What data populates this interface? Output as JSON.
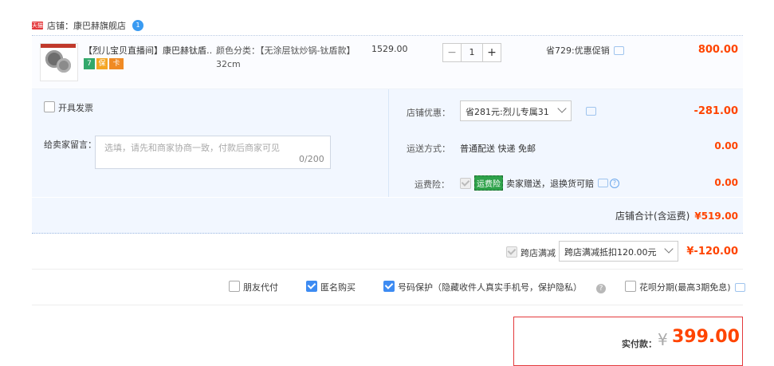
{
  "shop": {
    "badge": "天猫",
    "label": "店铺：",
    "name": "康巴赫旗舰店",
    "ww_badge": "1"
  },
  "item": {
    "title": "【烈儿宝贝直播间】康巴赫钛盾…",
    "badges": [
      "7",
      "保",
      "卡"
    ],
    "sku": "颜色分类：【无涂层钛炒锅-钛盾款】32cm",
    "price": "1529.00",
    "quantity": "1",
    "minus": "−",
    "plus": "+",
    "promo": "省729:优惠促销",
    "subtotal": "800.00"
  },
  "invoice": {
    "label": "开具发票",
    "checked": false
  },
  "message": {
    "label": "给卖家留言：",
    "placeholder": "选填，请先和商家协商一致，付款后商家可见",
    "count": "0/200"
  },
  "shop_discount": {
    "label": "店铺优惠：",
    "selected": "省281元:烈儿专属31",
    "value": "-281.00"
  },
  "shipping": {
    "label": "运送方式：",
    "method": "普通配送 快递 免邮",
    "price": "0.00"
  },
  "insurance": {
    "label": "运费险：",
    "tag": "运费险",
    "text": "卖家赠送，退换货可赔",
    "price": "0.00"
  },
  "shop_total": {
    "label": "店铺合计(含运费)",
    "amount": "¥519.00"
  },
  "cross_store": {
    "label": "跨店满减",
    "selected": "跨店满减抵扣120.00元",
    "value": "¥-120.00"
  },
  "options": {
    "friend_pay": "朋友代付",
    "anonymous": "匿名购买",
    "privacy": "号码保护（隐藏收件人真实手机号，保护隐私）",
    "installment": "花呗分期(最高3期免息)"
  },
  "payment": {
    "label": "实付款：",
    "symbol": "¥",
    "amount": "399.00"
  },
  "colors": {
    "accent": "#ff4400",
    "border_red": "#e4393c",
    "bg_blue": "#f2f7ff",
    "check_blue": "#3d8bf2"
  }
}
